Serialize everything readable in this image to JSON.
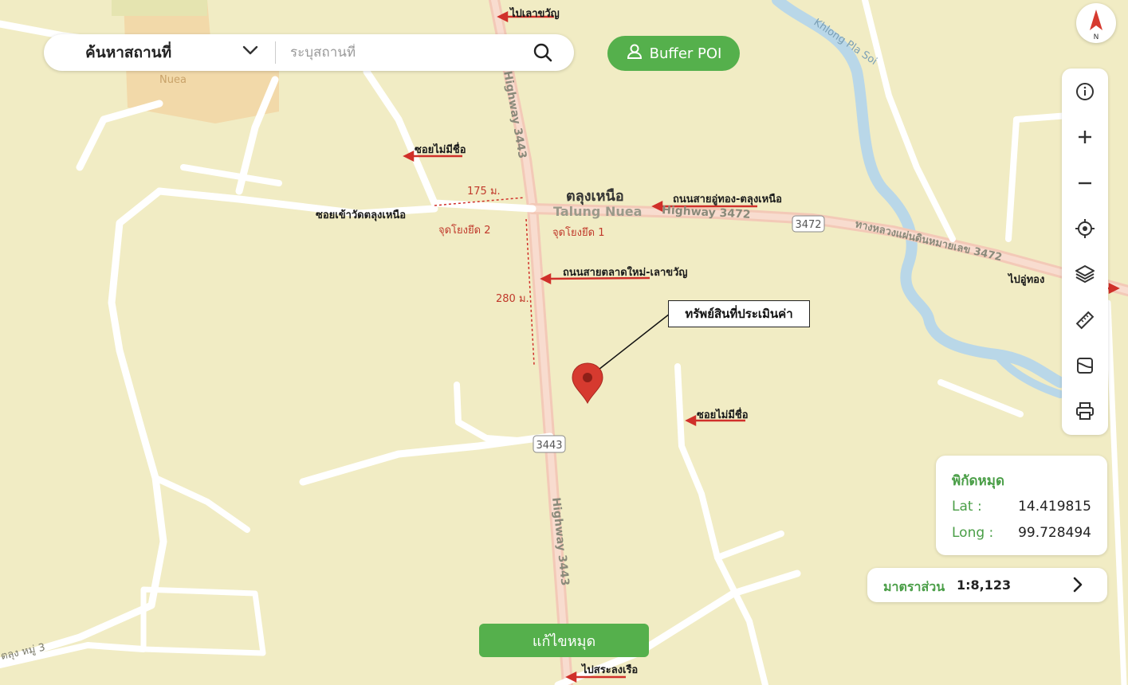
{
  "search": {
    "type_label": "ค้นหาสถานที่",
    "placeholder": "ระบุสถานที่",
    "value": ""
  },
  "buffer_button": {
    "label": "Buffer POI"
  },
  "compass": {
    "north_label": "N"
  },
  "toolbar": {
    "tools": [
      "info-icon",
      "zoom-in-icon",
      "zoom-out-icon",
      "locate-icon",
      "layers-icon",
      "ruler-icon",
      "map-style-icon",
      "print-icon"
    ]
  },
  "coordinates": {
    "title": "พิกัดหมุด",
    "lat_label": "Lat :",
    "lat_value": "14.419815",
    "long_label": "Long :",
    "long_value": "99.728494"
  },
  "scale": {
    "label": "มาตราส่วน",
    "value": "1:8,123"
  },
  "edit_button": {
    "label": "แก้ไขหมุด"
  },
  "callout": {
    "label": "ทรัพย์สินที่ประเมินค่า"
  },
  "map_labels": {
    "to_lao_khwan": "ไปเลาขวัญ",
    "soi_no_name_1": "ซอยไม่มีชื่อ",
    "soi_no_name_2": "ซอยไม่มีชื่อ",
    "soi_wat": "ซอยเข้าวัดตลุงเหนือ",
    "road_u_thong": "ถนนสายอู่ทอง-ตลุงเหนือ",
    "road_talad_mai": "ถนนสายตลาดใหม่-เลาขวัญ",
    "to_u_thong": "ไปอู่ทอง",
    "to_sa_long_ruea": "ไปสระลงเรือ",
    "dist_175": "175 ม.",
    "dist_280": "280 ม.",
    "ref_point_1": "จุดโยงยึด 1",
    "ref_point_2": "จุดโยงยึด 2"
  },
  "base_map": {
    "place_thai": "ตลุงเหนือ",
    "place_en": "Talung Nuea",
    "nuea": "Nuea",
    "highway_3472": "Highway 3472",
    "highway_3443_top": "Highway 3443",
    "highway_3443_bottom": "Highway 3443",
    "shield_3472": "3472",
    "shield_3443": "3443",
    "river": "Khlong Pla Soi",
    "highway_thai": "ทางหลวงแผ่นดินหมายเลข 3472",
    "moo3": "ตลุง หมู่ 3"
  },
  "colors": {
    "accent_green": "#55b04c",
    "marker_red": "#d63a2f",
    "annotation_red": "#d0302a"
  }
}
